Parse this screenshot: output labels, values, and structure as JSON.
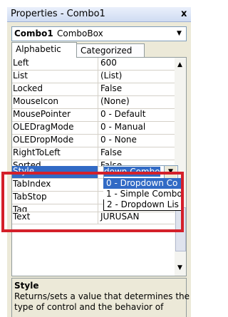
{
  "window": {
    "title": "Properties - Combo1",
    "close_glyph": "x"
  },
  "object_selector": {
    "name": "Combo1",
    "type": "ComboBox",
    "arrow_icon": "chevron-down-icon"
  },
  "tabs": [
    {
      "label": "Alphabetic"
    },
    {
      "label": "Categorized"
    }
  ],
  "properties": [
    {
      "name": "Left",
      "value": "600"
    },
    {
      "name": "List",
      "value": "(List)"
    },
    {
      "name": "Locked",
      "value": "False"
    },
    {
      "name": "MouseIcon",
      "value": "(None)"
    },
    {
      "name": "MousePointer",
      "value": "0 - Default"
    },
    {
      "name": "OLEDragMode",
      "value": "0 - Manual"
    },
    {
      "name": "OLEDropMode",
      "value": "0 - None"
    },
    {
      "name": "RightToLeft",
      "value": "False"
    },
    {
      "name": "Sorted",
      "value": "False"
    },
    {
      "name": "Style",
      "value": ""
    },
    {
      "name": "TabIndex",
      "value": ""
    },
    {
      "name": "TabStop",
      "value": ""
    },
    {
      "name": "Tag",
      "value": ""
    },
    {
      "name": "Text",
      "value": "JURUSAN"
    }
  ],
  "selected_property": "Style",
  "style_editor": {
    "current_value": "down Combo",
    "arrow_icon": "chevron-down-icon"
  },
  "style_options": [
    {
      "label": "0 - Dropdown Co",
      "highlighted": true
    },
    {
      "label": "1 - Simple Combo",
      "highlighted": false
    },
    {
      "label": "2 - Dropdown Lis",
      "highlighted": false
    }
  ],
  "description": {
    "title": "Style",
    "text": "Returns/sets a value that determines the type of control and the behavior of"
  },
  "colors": {
    "selection": "#316ac5",
    "highlight_box": "#d4202a"
  }
}
